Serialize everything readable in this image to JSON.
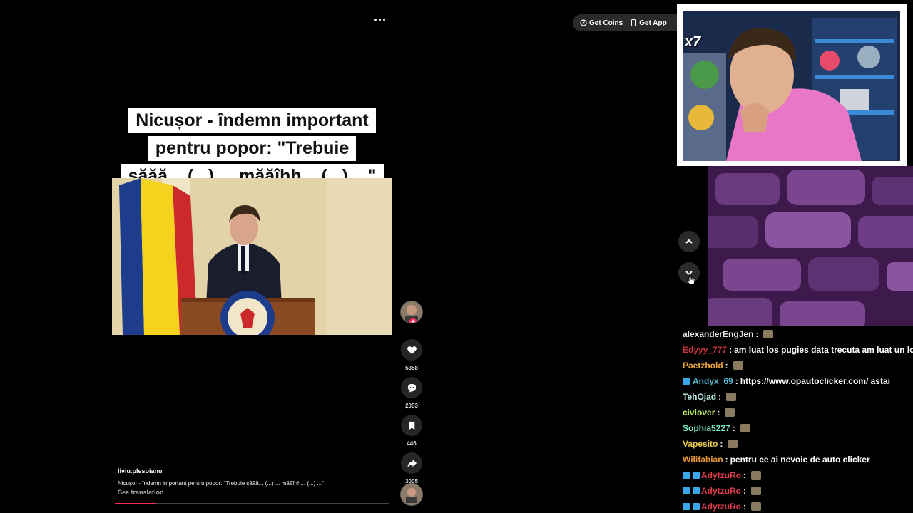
{
  "topbar": {
    "get_coins": "Get Coins",
    "get_app": "Get App"
  },
  "caption_overlay": {
    "lines": [
      "Nicușor - îndemn important",
      "pentru popor: \"Trebuie",
      "săăă... (...) ... măăîhh... (...) ...\""
    ]
  },
  "video_info": {
    "author": "liviu.plesoianu",
    "description": "Nicușor - îndemn important pentru popor: \"Trebuie săăă... (...) ... măăîhh... (...) ...\"",
    "see_translation": "See translation",
    "progress_fraction": 0.15
  },
  "actions": {
    "likes": "5358",
    "comments": "2053",
    "saves": "446",
    "shares": "3005",
    "follow_symbol": "+"
  },
  "stream_overlay": {
    "multiplier": "x7"
  },
  "chat": [
    {
      "user": "alexanderEngJen",
      "color": "#e8e8e8",
      "badges": 0,
      "text": "",
      "emote": true
    },
    {
      "user": "Edyyy_777",
      "color": "#c8323c",
      "badges": 0,
      "text": "am luat los pugies data trecuta am luat un lo",
      "emote": false
    },
    {
      "user": "Paetzhold",
      "color": "#e8a23a",
      "badges": 0,
      "text": "",
      "emote": true
    },
    {
      "user": "Andyx_69",
      "color": "#4fb8d0",
      "badges": 1,
      "text": "https://www.opautoclicker.com/ astai",
      "emote": false
    },
    {
      "user": "TehOjad",
      "color": "#b8e8e0",
      "badges": 0,
      "text": "",
      "emote": true
    },
    {
      "user": "civlover",
      "color": "#b8e85a",
      "badges": 0,
      "text": "",
      "emote": true
    },
    {
      "user": "Sophia5227",
      "color": "#7ae8c8",
      "badges": 0,
      "text": "",
      "emote": true
    },
    {
      "user": "Vapesito",
      "color": "#e8c84a",
      "badges": 0,
      "text": "",
      "emote": true
    },
    {
      "user": "Wilifabian",
      "color": "#e89a3a",
      "badges": 0,
      "text": "pentru ce ai nevoie de auto clicker",
      "emote": false
    },
    {
      "user": "AdytzuRo",
      "color": "#e03a4a",
      "badges": 2,
      "text": "",
      "emote": true
    },
    {
      "user": "AdytzuRo",
      "color": "#e03a4a",
      "badges": 2,
      "text": "",
      "emote": true
    },
    {
      "user": "AdytzuRo",
      "color": "#e03a4a",
      "badges": 2,
      "text": "",
      "emote": true
    }
  ],
  "colors": {
    "accent": "#fe2c55",
    "bg": "#000000"
  }
}
